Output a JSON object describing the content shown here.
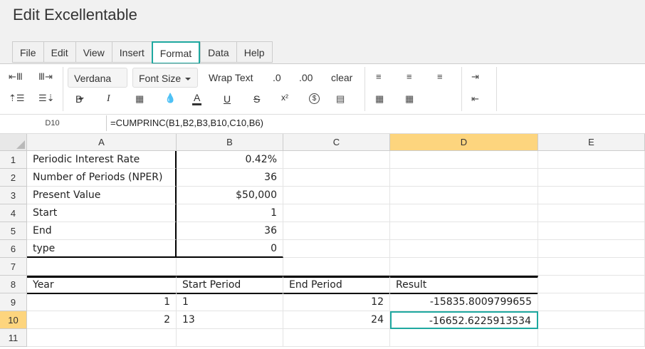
{
  "app": {
    "title": "Edit Excellentable"
  },
  "menu": {
    "tabs": [
      "File",
      "Edit",
      "View",
      "Insert",
      "Format",
      "Data",
      "Help"
    ],
    "active": "Format"
  },
  "toolbar": {
    "font": "Verdana",
    "font_size": "Font Size",
    "wrap_text": "Wrap Text",
    "dec_decrease": ".0",
    "dec_increase": ".00",
    "clear": "clear",
    "bold": "B",
    "italic": "I",
    "text_color": "A",
    "underline": "U",
    "strike": "S",
    "superscript": "x²",
    "currency": "$"
  },
  "formula_bar": {
    "cell_ref": "D10",
    "formula": "=CUMPRINC(B1,B2,B3,B10,C10,B6)"
  },
  "sheet": {
    "columns": [
      "A",
      "B",
      "C",
      "D",
      "E"
    ],
    "rows": [
      "1",
      "2",
      "3",
      "4",
      "5",
      "6",
      "7",
      "8",
      "9",
      "10",
      "11"
    ],
    "cells": [
      [
        "Periodic Interest Rate",
        "0.42%",
        "",
        "",
        ""
      ],
      [
        "Number of Periods (NPER)",
        "36",
        "",
        "",
        ""
      ],
      [
        "Present Value",
        "$50,000",
        "",
        "",
        ""
      ],
      [
        "Start",
        "1",
        "",
        "",
        ""
      ],
      [
        "End",
        "36",
        "",
        "",
        ""
      ],
      [
        "type",
        "0",
        "",
        "",
        ""
      ],
      [
        "",
        "",
        "",
        "",
        ""
      ],
      [
        "Year",
        "Start Period",
        "End Period",
        "Result",
        ""
      ],
      [
        "1",
        "1",
        "12",
        "-15835.8009799655",
        ""
      ],
      [
        "2",
        "13",
        "24",
        "-16652.6225913534",
        ""
      ],
      [
        "",
        "",
        "",
        "",
        ""
      ]
    ],
    "selected": {
      "column": "D",
      "row": "10"
    }
  }
}
